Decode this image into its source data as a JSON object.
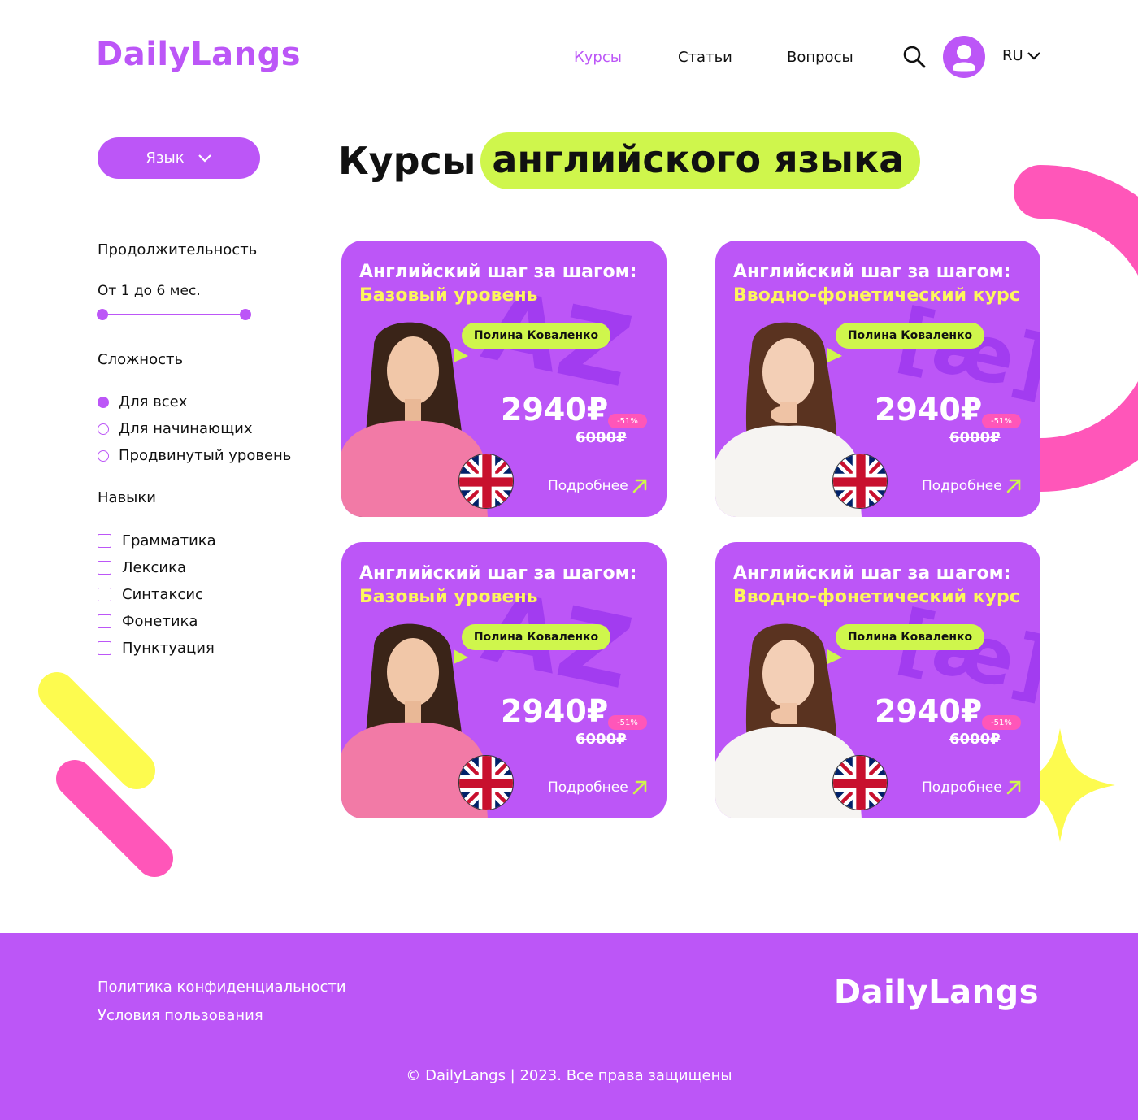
{
  "header": {
    "logo": "DailyLangs",
    "nav": [
      {
        "label": "Курсы",
        "active": true
      },
      {
        "label": "Статьи",
        "active": false
      },
      {
        "label": "Вопросы",
        "active": false
      }
    ],
    "language": "RU"
  },
  "filters": {
    "language_button": "Язык",
    "duration": {
      "title": "Продолжительность",
      "range_text": "От 1 до 6 мес."
    },
    "difficulty": {
      "title": "Сложность",
      "options": [
        "Для всех",
        "Для начинающих",
        "Продвинутый уровень"
      ],
      "selected": "Для всех"
    },
    "skills": {
      "title": "Навыки",
      "options": [
        "Грамматика",
        "Лексика",
        "Синтаксис",
        "Фонетика",
        "Пунктуация"
      ]
    }
  },
  "main": {
    "title_part1": "Курсы",
    "title_part2": "английского языка"
  },
  "cards": [
    {
      "title": "Английский шаг за шагом:",
      "subtitle": "Базовый уровень",
      "glyph": "AZ",
      "tutor": "Полина Коваленко",
      "price": "2940₽",
      "old_price": "6000₽",
      "discount": "-51%",
      "more": "Подробнее"
    },
    {
      "title": "Английский шаг за шагом:",
      "subtitle": "Вводно-фонетический курс",
      "glyph": "[æ]",
      "tutor": "Полина Коваленко",
      "price": "2940₽",
      "old_price": "6000₽",
      "discount": "-51%",
      "more": "Подробнее"
    },
    {
      "title": "Английский шаг за шагом:",
      "subtitle": "Базовый уровень",
      "glyph": "AZ",
      "tutor": "Полина Коваленко",
      "price": "2940₽",
      "old_price": "6000₽",
      "discount": "-51%",
      "more": "Подробнее"
    },
    {
      "title": "Английский шаг за шагом:",
      "subtitle": "Вводно-фонетический курс",
      "glyph": "[æ]",
      "tutor": "Полина Коваленко",
      "price": "2940₽",
      "old_price": "6000₽",
      "discount": "-51%",
      "more": "Подробнее"
    }
  ],
  "footer": {
    "links": [
      "Политика конфиденциальности",
      "Условия пользования"
    ],
    "logo": "DailyLangs",
    "copyright": "© DailyLangs | 2023. Все права защищены"
  },
  "colors": {
    "accent": "#bc56f7",
    "lime": "#cff64c",
    "yellow": "#fdf65c",
    "pink": "#ff56b9"
  },
  "icons": [
    "search-icon",
    "user-icon",
    "chevron-down-icon",
    "arrow-up-right-icon",
    "uk-flag-icon"
  ]
}
